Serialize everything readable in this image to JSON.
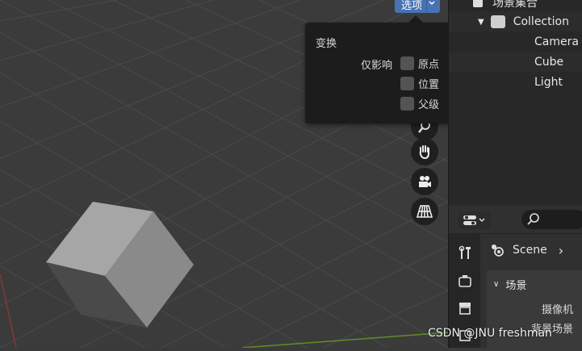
{
  "header": {
    "options_label": "选项"
  },
  "popover": {
    "title": "变换",
    "affect_only_label": "仅影响",
    "options": [
      {
        "label": "原点",
        "checked": false
      },
      {
        "label": "位置",
        "checked": false
      },
      {
        "label": "父级",
        "checked": false
      }
    ]
  },
  "outliner": {
    "top_item": "场景集合",
    "collection": "Collection",
    "objects": [
      "Camera",
      "Cube",
      "Light"
    ]
  },
  "properties": {
    "scene_label": "Scene",
    "panel_title": "场景",
    "rows": [
      "摄像机",
      "背景场景"
    ]
  },
  "watermark": "CSDN @JNU freshman",
  "icons": [
    "zoom-icon",
    "hand-icon",
    "camera-icon",
    "grid-icon",
    "wrench-icon",
    "render-icon",
    "output-icon",
    "scene-icon",
    "search-icon"
  ],
  "colors": {
    "accent": "#4772b3",
    "axis_red": "#9a3a3a",
    "axis_green": "#6a9a2a"
  }
}
